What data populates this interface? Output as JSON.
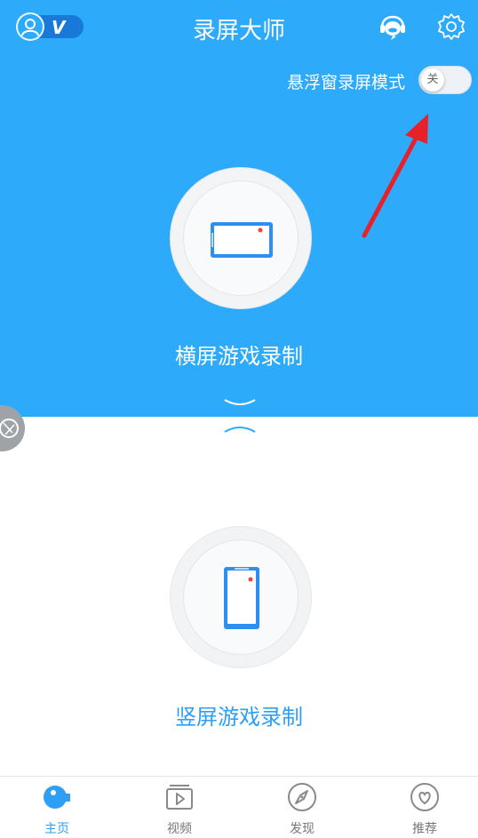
{
  "header": {
    "title": "录屏大师",
    "vip_badge": "V",
    "service_icon": "customer-service-icon",
    "settings_icon": "gear-icon"
  },
  "float_mode": {
    "label": "悬浮窗录屏模式",
    "toggle_state": "关"
  },
  "modes": {
    "landscape": {
      "label": "横屏游戏录制",
      "icon": "landscape-phone-icon"
    },
    "portrait": {
      "label": "竖屏游戏录制",
      "icon": "portrait-phone-icon"
    }
  },
  "tabs": [
    {
      "label": "主页",
      "icon": "camera-icon",
      "active": true
    },
    {
      "label": "视频",
      "icon": "video-play-icon",
      "active": false
    },
    {
      "label": "发现",
      "icon": "compass-icon",
      "active": false
    },
    {
      "label": "推荐",
      "icon": "heart-icon",
      "active": false
    }
  ],
  "colors": {
    "primary": "#2eaafa",
    "accent_text": "#2e9ff5",
    "vip": "#1979d8",
    "annotation": "#e8202a"
  }
}
